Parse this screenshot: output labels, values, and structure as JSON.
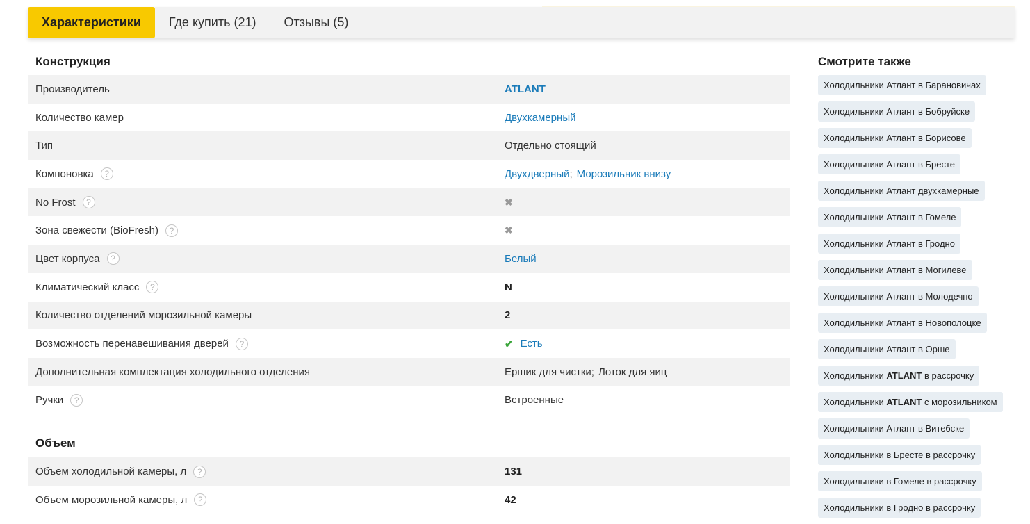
{
  "tabs": [
    {
      "label": "Характеристики",
      "active": true
    },
    {
      "label": "Где купить (21)",
      "active": false
    },
    {
      "label": "Отзывы (5)",
      "active": false
    }
  ],
  "sections": [
    {
      "title": "Конструкция",
      "rows": [
        {
          "label": "Производитель",
          "value": "ATLANT"
        },
        {
          "label": "Количество камер",
          "value": "Двухкамерный"
        },
        {
          "label": "Тип",
          "value": "Отдельно стоящий"
        },
        {
          "label": "Компоновка",
          "value1": "Двухдверный",
          "value2": "Морозильник внизу"
        },
        {
          "label": "No Frost",
          "value": "✖"
        },
        {
          "label": "Зона свежести (BioFresh)",
          "value": "✖"
        },
        {
          "label": "Цвет корпуса",
          "value": "Белый"
        },
        {
          "label": "Климатический класс",
          "value": "N"
        },
        {
          "label": "Количество отделений морозильной камеры",
          "value": "2"
        },
        {
          "label": "Возможность перенавешивания дверей",
          "value": "Есть"
        },
        {
          "label": "Дополнительная комплектация холодильного отделения",
          "value1": "Ершик для чистки",
          "value2": "Лоток для яиц"
        },
        {
          "label": "Ручки",
          "value": "Встроенные"
        }
      ]
    },
    {
      "title": "Объем",
      "rows": [
        {
          "label": "Объем холодильной камеры, л",
          "value": "131"
        },
        {
          "label": "Объем морозильной камеры, л",
          "value": "42"
        }
      ]
    }
  ],
  "help_symbol": "?",
  "check_symbol": "✔",
  "separator": ";",
  "sidebar": {
    "title": "Смотрите также",
    "links": [
      "Холодильники Атлант в Барановичах",
      "Холодильники Атлант в Бобруйске",
      "Холодильники Атлант в Борисове",
      "Холодильники Атлант в Бресте",
      "Холодильники Атлант двухкамерные",
      "Холодильники Атлант в Гомеле",
      "Холодильники Атлант в Гродно",
      "Холодильники Атлант в Могилеве",
      "Холодильники Атлант в Молодечно",
      "Холодильники Атлант в Новополоцке",
      "Холодильники Атлант в Орше",
      {
        "pre": "Холодильники ",
        "bold": "ATLANT",
        "post": " в рассрочку"
      },
      {
        "pre": "Холодильники ",
        "bold": "ATLANT",
        "post": " с морозильником"
      },
      "Холодильники Атлант в Витебске",
      "Холодильники в Бресте в рассрочку",
      "Холодильники в Гомеле в рассрочку",
      "Холодильники в Гродно в рассрочку"
    ]
  },
  "colors": {
    "accent": "#f8c900",
    "link": "#1a7bb9",
    "check": "#3aa53a",
    "row_alt": "#f2f2f2",
    "chip_bg": "#e8eef3"
  }
}
